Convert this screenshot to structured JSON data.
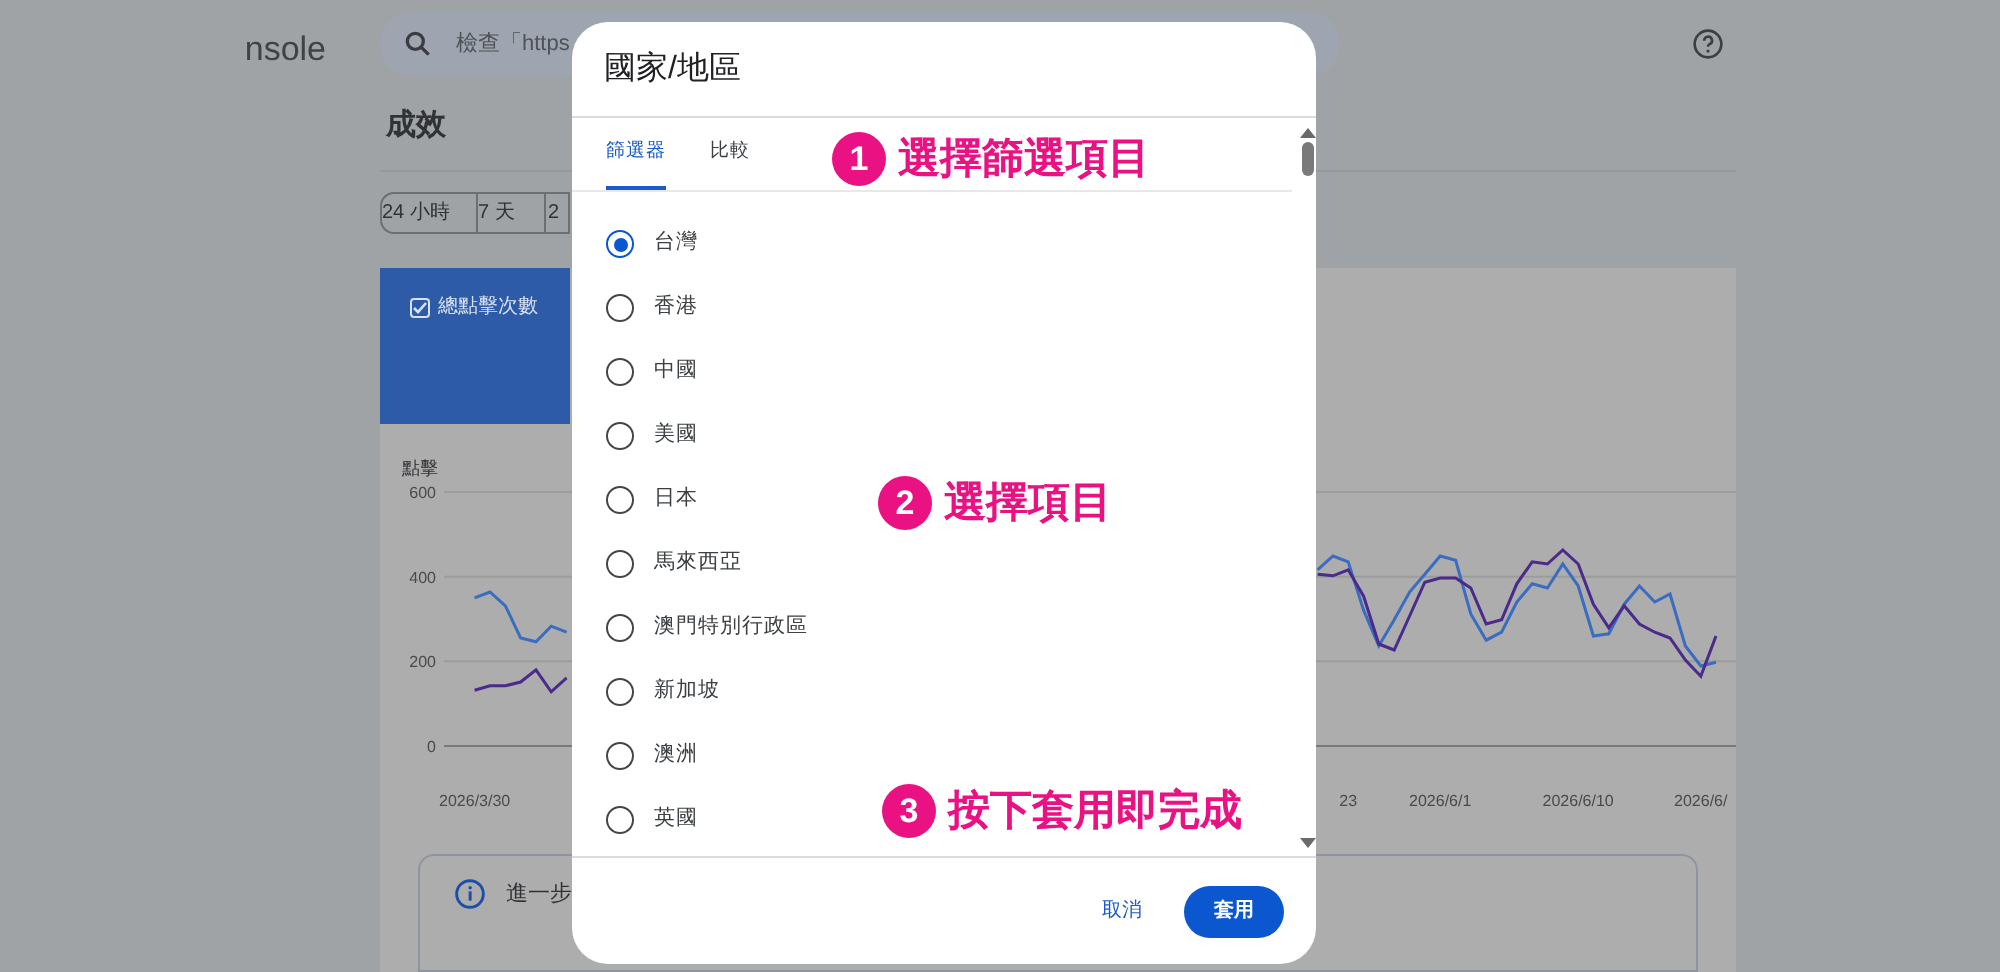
{
  "app": {
    "logo_text": "nsole",
    "search_placeholder": "檢查「https"
  },
  "page_title": "成效",
  "date_ranges": [
    {
      "label": "24 小時"
    },
    {
      "label": "7 天"
    },
    {
      "label": "2"
    }
  ],
  "metric_card": {
    "label": "總點擊次數",
    "checked": true
  },
  "chart": {
    "chart_data": {
      "type": "line",
      "ylabel": "點擊",
      "ylim": [
        0,
        600
      ],
      "yticks": [
        0,
        200,
        400,
        600
      ],
      "categories": [
        "2026/3/30",
        null,
        null,
        null,
        null,
        null,
        null,
        null,
        null,
        null,
        null,
        null,
        null,
        null,
        null,
        null,
        null,
        null,
        null,
        null,
        null,
        null,
        null,
        null,
        null,
        null,
        null,
        null,
        null,
        null,
        null,
        null,
        null,
        null,
        null,
        null,
        null,
        null,
        null,
        null,
        null,
        null,
        null,
        null,
        null,
        null,
        null,
        null,
        null,
        null,
        null,
        null,
        null,
        null,
        null,
        null,
        null,
        "23",
        null,
        null,
        null,
        null,
        null,
        "2026/6/1",
        null,
        null,
        null,
        null,
        null,
        null,
        null,
        null,
        "2026/6/10",
        null,
        null,
        null,
        null,
        null,
        null,
        null,
        "2026/6/",
        null
      ],
      "series": [
        {
          "color": "#3a6cc0",
          "values": [
            350,
            364,
            331,
            255,
            246,
            283,
            269,
            null,
            null,
            null,
            null,
            null,
            null,
            null,
            null,
            null,
            null,
            null,
            null,
            null,
            null,
            null,
            null,
            null,
            null,
            null,
            null,
            null,
            null,
            null,
            null,
            null,
            null,
            null,
            null,
            null,
            null,
            null,
            null,
            null,
            null,
            null,
            null,
            null,
            null,
            null,
            null,
            null,
            null,
            null,
            null,
            null,
            null,
            null,
            null,
            416,
            449,
            435,
            321,
            236,
            298,
            364,
            406,
            449,
            439,
            312,
            250,
            269,
            340,
            383,
            373,
            430,
            378,
            260,
            265,
            335,
            378,
            340,
            359,
            236,
            189,
            198
          ]
        },
        {
          "color": "#4a2a8a",
          "values": [
            132,
            142,
            142,
            151,
            180,
            128,
            161,
            null,
            null,
            null,
            null,
            null,
            null,
            null,
            null,
            null,
            null,
            null,
            null,
            null,
            null,
            null,
            null,
            null,
            null,
            null,
            null,
            null,
            null,
            null,
            null,
            null,
            null,
            null,
            null,
            null,
            null,
            null,
            null,
            null,
            null,
            null,
            null,
            null,
            null,
            null,
            null,
            null,
            null,
            null,
            null,
            null,
            null,
            null,
            null,
            406,
            402,
            416,
            354,
            241,
            227,
            307,
            387,
            397,
            397,
            373,
            288,
            298,
            383,
            435,
            430,
            463,
            430,
            335,
            279,
            331,
            288,
            269,
            255,
            203,
            165,
            260
          ]
        }
      ]
    }
  },
  "info_text": "進一步",
  "dialog": {
    "title": "國家/地區",
    "tabs": [
      {
        "label": "篩選器",
        "selected": true
      },
      {
        "label": "比較",
        "selected": false
      }
    ],
    "options": [
      {
        "label": "台灣",
        "selected": true
      },
      {
        "label": "香港",
        "selected": false
      },
      {
        "label": "中國",
        "selected": false
      },
      {
        "label": "美國",
        "selected": false
      },
      {
        "label": "日本",
        "selected": false
      },
      {
        "label": "馬來西亞",
        "selected": false
      },
      {
        "label": "澳門特別行政區",
        "selected": false
      },
      {
        "label": "新加坡",
        "selected": false
      },
      {
        "label": "澳洲",
        "selected": false
      },
      {
        "label": "英國",
        "selected": false
      }
    ],
    "cancel": "取消",
    "apply": "套用"
  },
  "annotations": [
    {
      "number": "1",
      "text": "選擇篩選項目"
    },
    {
      "number": "2",
      "text": "選擇項目"
    },
    {
      "number": "3",
      "text": "按下套用即完成"
    }
  ]
}
